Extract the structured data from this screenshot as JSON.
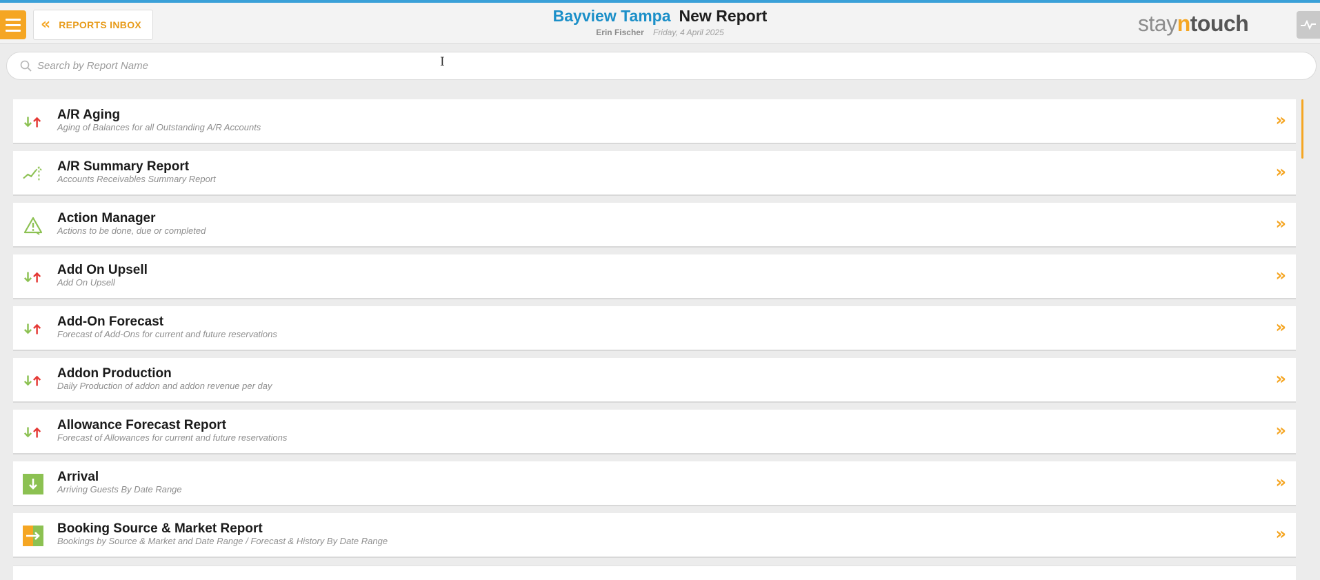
{
  "header": {
    "back_label": "REPORTS INBOX",
    "hotel_name": "Bayview Tampa",
    "page_title": "New Report",
    "user_name": "Erin Fischer",
    "date": "Friday, 4 April 2025",
    "brand": {
      "stay": "stay",
      "n": "n",
      "touch": "touch"
    }
  },
  "search": {
    "placeholder": "Search by Report Name",
    "value": ""
  },
  "colors": {
    "accent": "#f5a623",
    "hotel_blue": "#1b8fc8",
    "green": "#8cc152",
    "red": "#e53935"
  },
  "reports": [
    {
      "name": "A/R Aging",
      "description": "Aging of Balances for all Outstanding A/R Accounts",
      "icon": "up-down-arrows-icon"
    },
    {
      "name": "A/R Summary Report",
      "description": "Accounts Receivables Summary Report",
      "icon": "trend-chart-icon"
    },
    {
      "name": "Action Manager",
      "description": "Actions to be done, due or completed",
      "icon": "warning-icon"
    },
    {
      "name": "Add On Upsell",
      "description": "Add On Upsell",
      "icon": "up-down-arrows-icon"
    },
    {
      "name": "Add-On Forecast",
      "description": "Forecast of Add-Ons for current and future reservations",
      "icon": "up-down-arrows-icon"
    },
    {
      "name": "Addon Production",
      "description": "Daily Production of addon and addon revenue per day",
      "icon": "up-down-arrows-icon"
    },
    {
      "name": "Allowance Forecast Report",
      "description": "Forecast of Allowances for current and future reservations",
      "icon": "up-down-arrows-icon"
    },
    {
      "name": "Arrival",
      "description": "Arriving Guests By Date Range",
      "icon": "arrival-icon"
    },
    {
      "name": "Booking Source & Market Report",
      "description": "Bookings by Source & Market and Date Range / Forecast & History By Date Range",
      "icon": "booking-source-icon"
    }
  ]
}
